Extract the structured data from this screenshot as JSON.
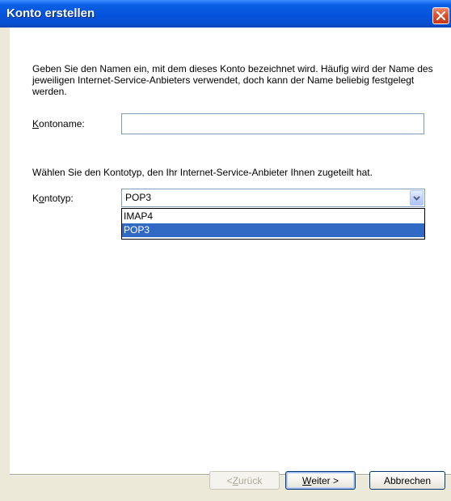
{
  "window": {
    "title": "Konto erstellen"
  },
  "intro": {
    "text": "Geben Sie den Namen ein, mit dem dieses Konto bezeichnet wird. Häufig wird der Name des jeweiligen Internet-Service-Anbieters verwendet, doch kann der Name beliebig festgelegt werden."
  },
  "account_name": {
    "label_first": "K",
    "label_rest": "ontoname:",
    "value": "",
    "placeholder": ""
  },
  "account_type": {
    "instruction": "Wählen Sie den Kontotyp, den Ihr Internet-Service-Anbieter Ihnen zugeteilt hat.",
    "label_first": "K",
    "label_underlined": "o",
    "label_rest": "ntotyp:",
    "selected": "POP3",
    "options": [
      "IMAP4",
      "POP3"
    ]
  },
  "buttons": {
    "back_prefix": "< ",
    "back_underlined": "Z",
    "back_rest": "urück",
    "next_underlined": "W",
    "next_rest": "eiter >",
    "cancel": "Abbrechen"
  },
  "colors": {
    "title_bar": "#0553dc",
    "selection": "#316ac5",
    "dialog_bg": "#ece9d8"
  },
  "icons": {
    "close": "close-icon",
    "dropdown": "chevron-down-icon"
  }
}
